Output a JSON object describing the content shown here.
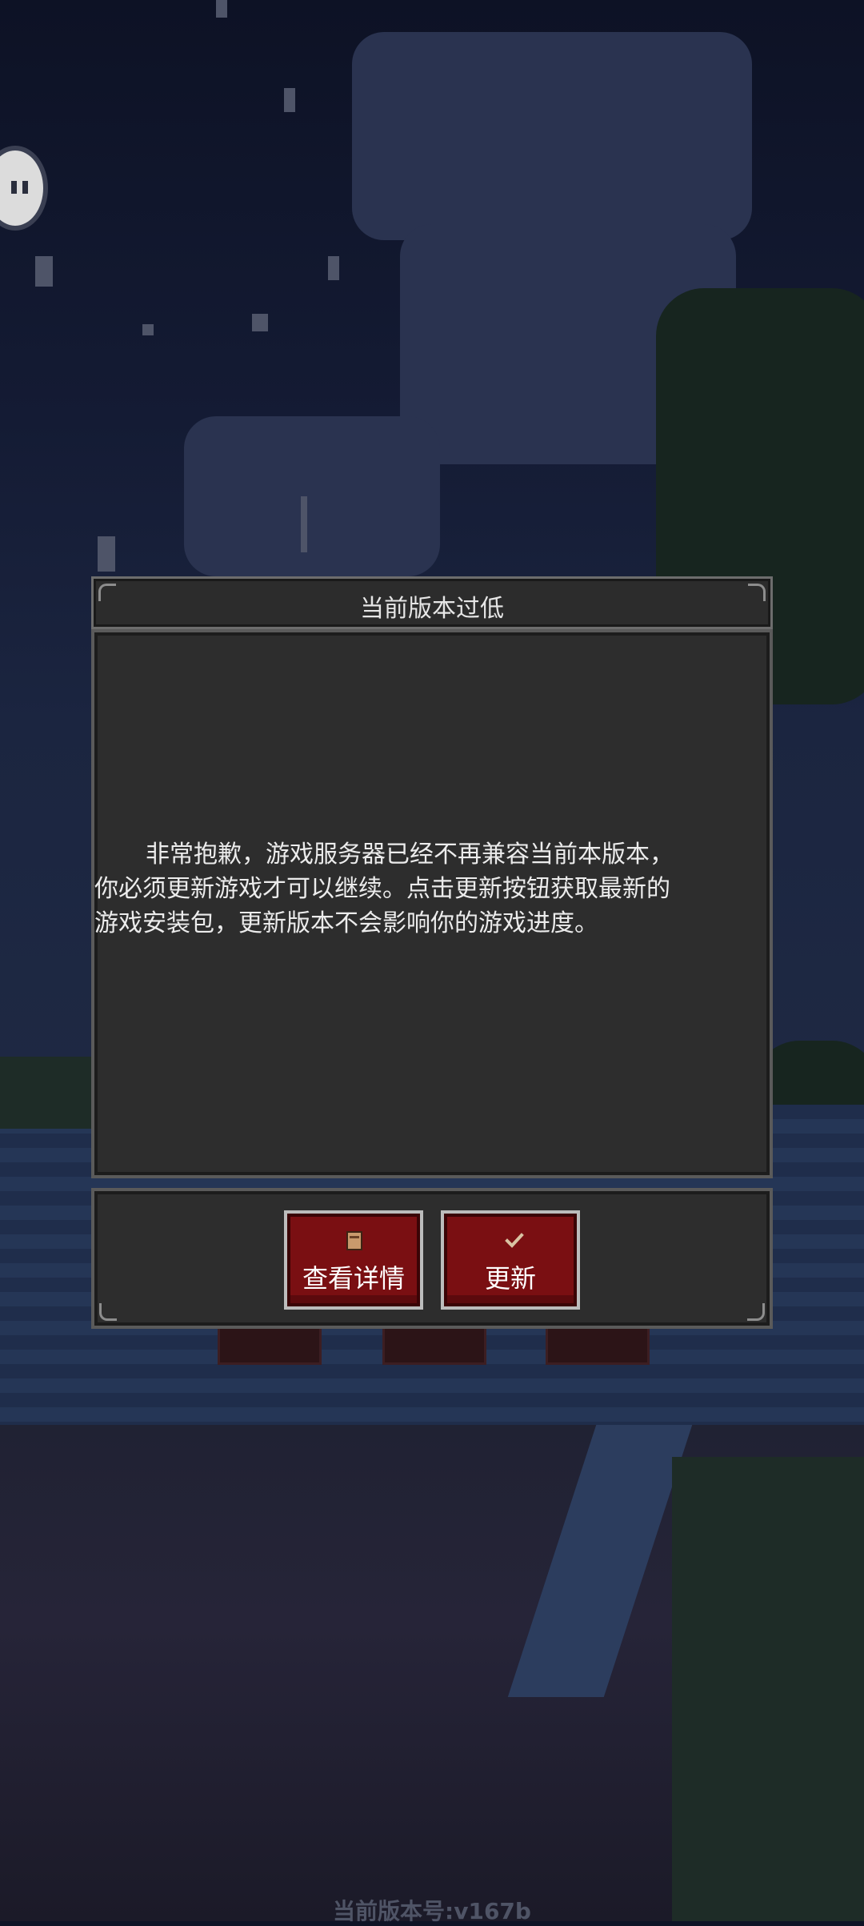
{
  "dialog": {
    "title": "当前版本过低",
    "message": "非常抱歉，游戏服务器已经不再兼容当前本版本，你必须更新游戏才可以继续。点击更新按钮获取最新的游戏安装包，更新版本不会影响你的游戏进度。",
    "buttons": {
      "details_label": "查看详情",
      "update_label": "更新"
    }
  },
  "footer": {
    "version": "当前版本号:v167b"
  },
  "icons": {
    "details": "book-icon",
    "update": "check-icon",
    "assistant": "robot-icon"
  },
  "colors": {
    "button_red": "#7a0f12",
    "dialog_bg": "#2d2d2d",
    "dialog_border": "#5a5a5a"
  }
}
